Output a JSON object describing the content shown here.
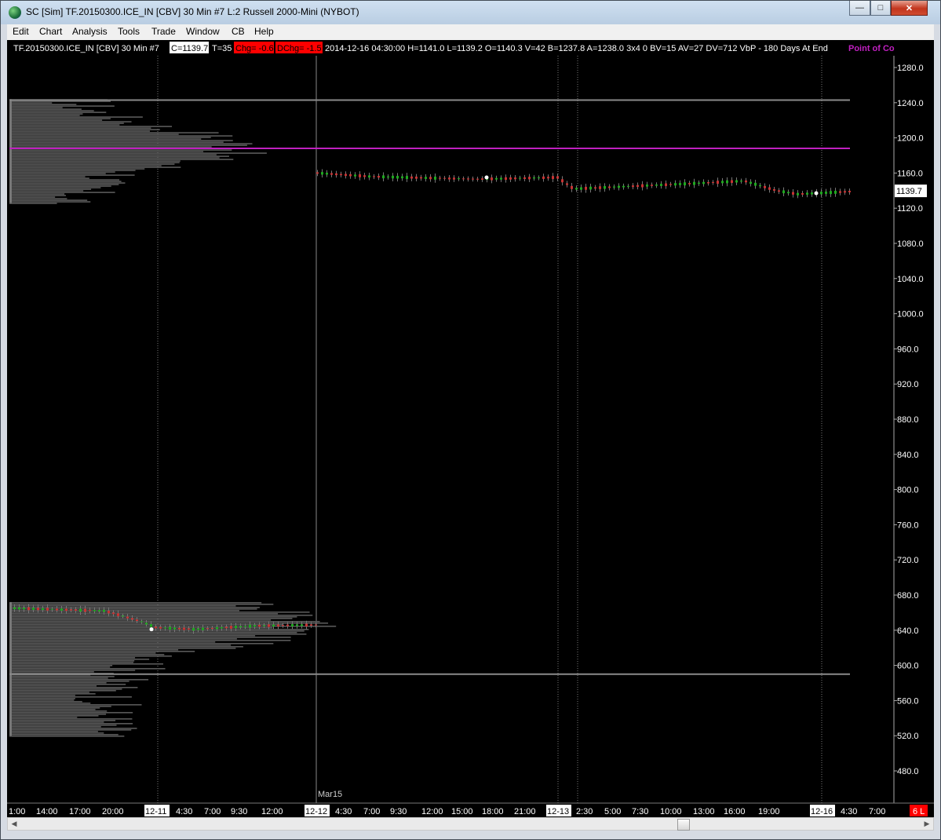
{
  "window": {
    "title": "SC [Sim] TF.20150300.ICE_IN [CBV]  30 Min   #7  L:2  Russell 2000-Mini (NYBOT)",
    "buttons": {
      "minimize": "—",
      "maximize": "□",
      "close": "✕"
    }
  },
  "menu": [
    "Edit",
    "Chart",
    "Analysis",
    "Tools",
    "Trade",
    "Window",
    "CB",
    "Help"
  ],
  "header": {
    "symbol": "TF.20150300.ICE_IN [CBV]  30 Min   #7",
    "close": "C=1139.7",
    "ticks": "T=35",
    "chg": "Chg= -0.6",
    "dchg": "DChg= -1.5",
    "stats": "2014-12-16 04:30:00 H=1141.0 L=1139.2 O=1140.3 V=42 B=1237.8 A=1238.0 3x4 0 BV=15 AV=27 DV=712  VbP - 180 Days At End",
    "study_label": "Point of Control",
    "colors": {
      "chg_bg": "#ff0000",
      "study": "#c020c0",
      "poc_line": "#c020c0"
    }
  },
  "price_axis": {
    "ticks": [
      "1280.0",
      "1240.0",
      "1200.0",
      "1160.0",
      "1120.0",
      "1080.0",
      "1040.0",
      "1000.0",
      "960.0",
      "920.0",
      "880.0",
      "840.0",
      "800.0",
      "760.0",
      "720.0",
      "680.0",
      "640.0",
      "600.0",
      "560.0",
      "520.0",
      "480.0"
    ],
    "current_price": "1139.7"
  },
  "time_axis": {
    "labels": [
      "1:00",
      "14:00",
      "17:00",
      "20:00",
      "12-11",
      "4:30",
      "7:00",
      "9:30",
      "12:00",
      "12-12",
      "4:30",
      "7:00",
      "9:30",
      "12:00",
      "15:00",
      "18:00",
      "21:00",
      "12-13",
      "2:30",
      "5:00",
      "7:30",
      "10:00",
      "13:00",
      "16:00",
      "19:00",
      "12-16",
      "4:30",
      "7:00"
    ],
    "boxed": [
      "12-11",
      "12-12",
      "12-13",
      "12-16"
    ],
    "corner_badge": "6 L",
    "contract_marker": "Mar15"
  },
  "chart_data": {
    "type": "candlestick",
    "timeframe": "30 Min",
    "price_range": [
      460,
      1290
    ],
    "volume_profile_upper_range": [
      1126,
      1244
    ],
    "volume_profile_lower_range": [
      520,
      672
    ],
    "point_of_control": 1188,
    "horizontal_levels": [
      1243,
      590
    ],
    "day_separators": [
      "12-11",
      "12-12",
      "12-13",
      "12-16"
    ],
    "last_price": 1139.7
  }
}
